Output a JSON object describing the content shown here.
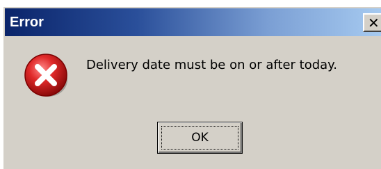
{
  "dialog": {
    "title": "Error",
    "close_glyph": "✕",
    "message": "Delivery date must be on or after today.",
    "icon": "error-icon",
    "ok_label": "OK"
  },
  "colors": {
    "titlebar_start": "#0a246a",
    "titlebar_end": "#a6caf0",
    "dialog_bg": "#d4d0c8",
    "error_red": "#d42a2a"
  }
}
